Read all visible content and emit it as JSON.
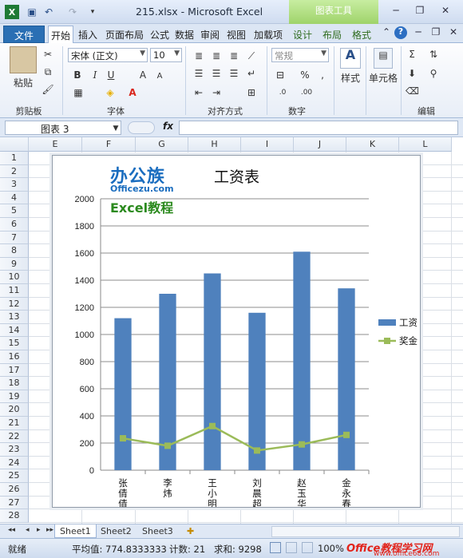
{
  "titlebar": {
    "filename": "215.xlsx",
    "separator": "-",
    "app": "Microsoft Excel",
    "chart_tools": "图表工具"
  },
  "tabs": {
    "file": "文件",
    "home": "开始",
    "insert": "插入",
    "page_layout": "页面布局",
    "formulas": "公式",
    "data": "数据",
    "review": "审阅",
    "view": "视图",
    "addins": "加载项",
    "design": "设计",
    "layout": "布局",
    "format": "格式"
  },
  "ribbon": {
    "clipboard": {
      "paste": "粘贴",
      "label": "剪贴板"
    },
    "font": {
      "name": "宋体 (正文)",
      "size": "10",
      "bold": "B",
      "italic": "I",
      "underline": "U",
      "grow": "A",
      "shrink": "A",
      "label": "字体"
    },
    "alignment": {
      "label": "对齐方式"
    },
    "number": {
      "format": "常规",
      "percent": "%",
      "comma": ",",
      "label": "数字"
    },
    "styles": {
      "label": "样式"
    },
    "cells": {
      "label": "单元格"
    },
    "editing": {
      "sigma": "Σ",
      "label": "编辑"
    }
  },
  "formula_bar": {
    "name_box": "图表 3",
    "fx": "fx",
    "value": ""
  },
  "grid": {
    "columns": [
      "E",
      "F",
      "G",
      "H",
      "I",
      "J",
      "K",
      "L"
    ],
    "rows": [
      "1",
      "2",
      "3",
      "4",
      "5",
      "6",
      "7",
      "8",
      "9",
      "10",
      "11",
      "12",
      "13",
      "14",
      "15",
      "16",
      "17",
      "18",
      "19",
      "20",
      "21",
      "22",
      "23",
      "24",
      "25",
      "26",
      "27",
      "28"
    ]
  },
  "logo": {
    "main": "办公族",
    "sub": "Officezu.com",
    "excel": "Excel教程"
  },
  "chart_data": {
    "type": "bar",
    "title": "工资表",
    "categories": [
      "张倩倩",
      "李炜",
      "王小明",
      "刘晨超",
      "赵玉华",
      "金永春"
    ],
    "series": [
      {
        "name": "工资",
        "type": "bar",
        "color": "#4f81bd",
        "values": [
          1120,
          1300,
          1450,
          1160,
          1610,
          1340
        ]
      },
      {
        "name": "奖金",
        "type": "line",
        "color": "#9bbb59",
        "values": [
          235,
          180,
          325,
          145,
          190,
          260
        ]
      }
    ],
    "ylim": [
      0,
      2000
    ],
    "yticks": [
      "0",
      "200",
      "400",
      "600",
      "800",
      "1000",
      "1200",
      "1400",
      "1600",
      "1800",
      "2000"
    ],
    "grid": true,
    "legend": "right"
  },
  "sheets": [
    "Sheet1",
    "Sheet2",
    "Sheet3"
  ],
  "status": {
    "ready": "就绪",
    "average": "平均值: 774.8333333",
    "count": "计数: 21",
    "sum": "求和: 9298",
    "zoom": "100%"
  },
  "watermark": {
    "text": "Office教程学习网",
    "url": "www.office68.com"
  }
}
